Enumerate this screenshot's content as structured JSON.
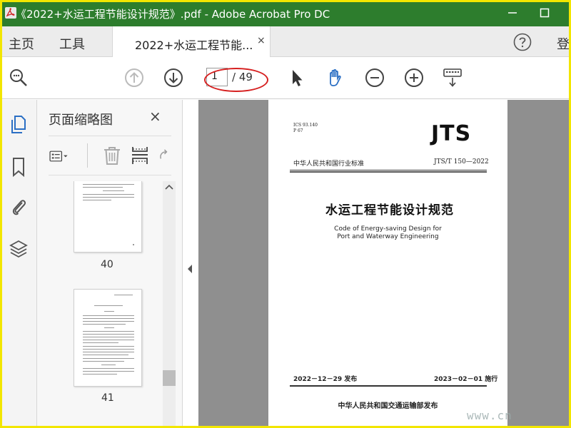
{
  "window": {
    "title": "《2022+水运工程节能设计规范》.pdf - Adobe Acrobat Pro DC"
  },
  "tabs": {
    "home_label": "主页",
    "tools_label": "工具",
    "document_tab_label": "2022+水运工程节能...",
    "close_symbol": "×",
    "login_label": "登"
  },
  "toolbar": {
    "current_page": "1",
    "total_pages": "/ 49"
  },
  "thumbnail_panel": {
    "title": "页面缩略图",
    "close_symbol": "×",
    "thumbnails": [
      {
        "page_number": "40"
      },
      {
        "page_number": "41"
      }
    ]
  },
  "document_page": {
    "ics_line1": "ICS 93.140",
    "ics_line2": "P 67",
    "logo_text": "JTS",
    "industry_standard": "中华人民共和国行业标准",
    "standard_number": "JTS/T 150—2022",
    "chinese_title": "水运工程节能设计规范",
    "english_title_line1": "Code of Energy-saving Design for",
    "english_title_line2": "Port and Waterway Engineering",
    "issue_date": "2022－12－29 发布",
    "effective_date": "2023－02－01 施行",
    "publisher": "中华人民共和国交通运输部发布"
  },
  "watermark": "www.cn",
  "colors": {
    "titlebar": "#2d7d2d",
    "frame": "#f2e600",
    "highlight_ellipse": "#d62020",
    "hand_tool": "#2b6fc4",
    "rail_active": "#2b6fc4"
  }
}
